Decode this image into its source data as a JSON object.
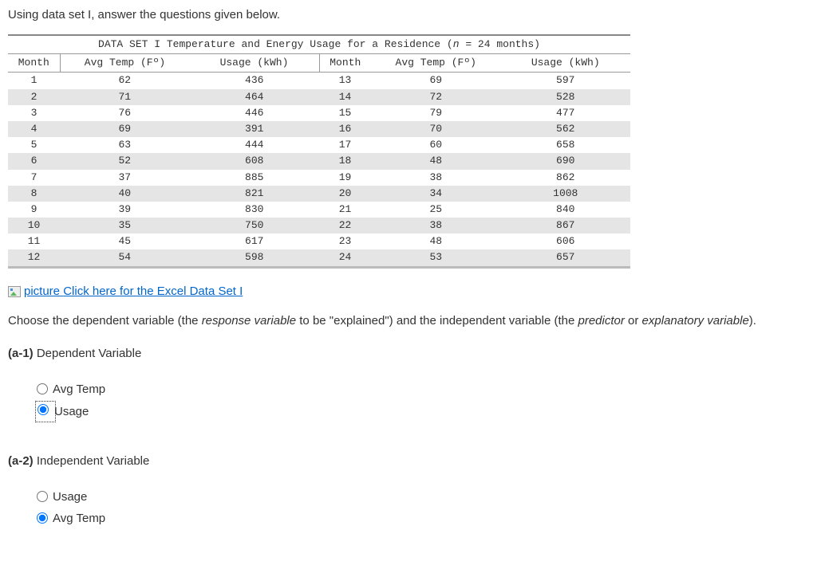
{
  "intro": "Using data set I, answer the questions given below.",
  "table": {
    "title_prefix": "DATA SET I Temperature and Energy Usage for a Residence (",
    "title_n": "n",
    "title_suffix": " = 24 months)",
    "headers": {
      "month": "Month",
      "temp": "Avg Temp (Fº)",
      "usage": "Usage (kWh)"
    },
    "rows_left": [
      {
        "month": "1",
        "temp": "62",
        "usage": "436"
      },
      {
        "month": "2",
        "temp": "71",
        "usage": "464"
      },
      {
        "month": "3",
        "temp": "76",
        "usage": "446"
      },
      {
        "month": "4",
        "temp": "69",
        "usage": "391"
      },
      {
        "month": "5",
        "temp": "63",
        "usage": "444"
      },
      {
        "month": "6",
        "temp": "52",
        "usage": "608"
      },
      {
        "month": "7",
        "temp": "37",
        "usage": "885"
      },
      {
        "month": "8",
        "temp": "40",
        "usage": "821"
      },
      {
        "month": "9",
        "temp": "39",
        "usage": "830"
      },
      {
        "month": "10",
        "temp": "35",
        "usage": "750"
      },
      {
        "month": "11",
        "temp": "45",
        "usage": "617"
      },
      {
        "month": "12",
        "temp": "54",
        "usage": "598"
      }
    ],
    "rows_right": [
      {
        "month": "13",
        "temp": "69",
        "usage": "597"
      },
      {
        "month": "14",
        "temp": "72",
        "usage": "528"
      },
      {
        "month": "15",
        "temp": "79",
        "usage": "477"
      },
      {
        "month": "16",
        "temp": "70",
        "usage": "562"
      },
      {
        "month": "17",
        "temp": "60",
        "usage": "658"
      },
      {
        "month": "18",
        "temp": "48",
        "usage": "690"
      },
      {
        "month": "19",
        "temp": "38",
        "usage": "862"
      },
      {
        "month": "20",
        "temp": "34",
        "usage": "1008"
      },
      {
        "month": "21",
        "temp": "25",
        "usage": "840"
      },
      {
        "month": "22",
        "temp": "38",
        "usage": "867"
      },
      {
        "month": "23",
        "temp": "48",
        "usage": "606"
      },
      {
        "month": "24",
        "temp": "53",
        "usage": "657"
      }
    ]
  },
  "link": {
    "alt": "picture",
    "text": "Click here for the Excel Data Set I"
  },
  "prompt": {
    "p1": "Choose the dependent variable (the ",
    "p2": "response variable",
    "p3": " to be \"explained\") and the independent variable (the ",
    "p4": "predictor",
    "p5": " or ",
    "p6": "explanatory variable",
    "p7": ")."
  },
  "q_a1": {
    "label_bold": "(a-1)",
    "label_rest": " Dependent Variable",
    "opt1": "Avg Temp",
    "opt2": "Usage"
  },
  "q_a2": {
    "label_bold": "(a-2)",
    "label_rest": " Independent Variable",
    "opt1": "Usage",
    "opt2": "Avg Temp"
  }
}
